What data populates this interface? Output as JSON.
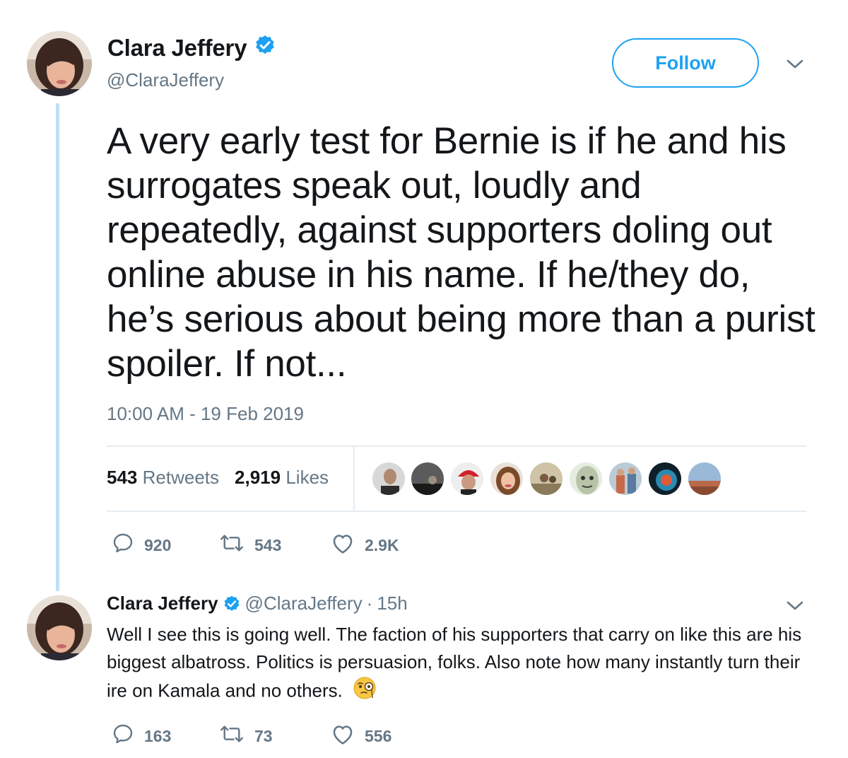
{
  "tweet": {
    "author_name": "Clara Jeffery",
    "author_handle": "@ClaraJeffery",
    "follow_label": "Follow",
    "text": "A very early test for Bernie is if he and his surrogates speak out, loudly and repeatedly, against supporters doling out online abuse in his name. If he/they do, he’s serious about being more than a purist spoiler. If not...",
    "timestamp": "10:00 AM - 19 Feb 2019",
    "retweets_count": "543",
    "retweets_label": "Retweets",
    "likes_count": "2,919",
    "likes_label": "Likes",
    "actions": {
      "replies": "920",
      "retweets": "543",
      "likes": "2.9K"
    }
  },
  "reply": {
    "author_name": "Clara Jeffery",
    "author_handle": "@ClaraJeffery",
    "separator": "·",
    "time_ago": "15h",
    "text": "Well I see this is going well. The faction of his supporters that carry on like this are his biggest albatross. Politics is persuasion, folks. Also note how many instantly turn their ire on Kamala and no others.",
    "emoji_icon": "face-with-monocle-icon",
    "actions": {
      "replies": "163",
      "retweets": "73",
      "likes": "556"
    }
  },
  "colors": {
    "accent": "#1da1f2",
    "secondary_text": "#657786",
    "primary_text": "#14171a",
    "thread_line": "#bfe0f7",
    "divider": "#e6ecf0"
  },
  "icons": [
    "verified-icon",
    "chevron-down-icon",
    "reply-icon",
    "retweet-icon",
    "heart-icon"
  ]
}
